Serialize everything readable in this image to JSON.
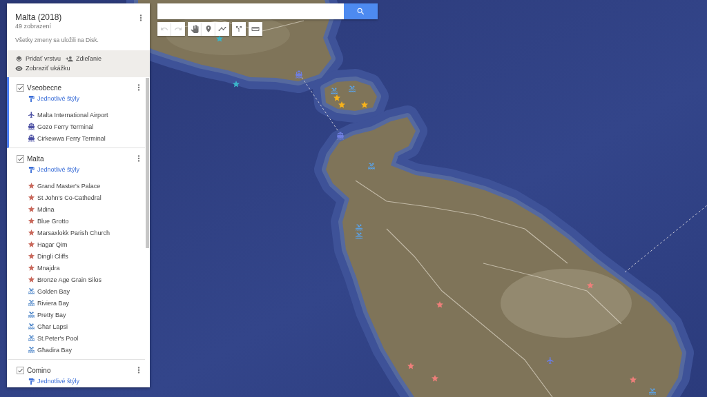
{
  "map": {
    "title": "Malta (2018)",
    "views": "49 zobrazení",
    "save_status": "Všetky zmeny sa uložili na Disk.",
    "actions": [
      {
        "kind": "add_layer",
        "label": "Pridať vrstvu"
      },
      {
        "kind": "share",
        "label": "Zdieľanie"
      },
      {
        "kind": "preview",
        "label": "Zobraziť ukážku"
      }
    ],
    "layers": [
      {
        "name": "Vseobecne",
        "checked": true,
        "selected": true,
        "style_link": "Jednotlivé štýly",
        "places": [
          {
            "name": "Malta International Airport",
            "kind": "airport"
          },
          {
            "name": "Gozo Ferry Terminal",
            "kind": "ferry"
          },
          {
            "name": "Cirkewwa Ferry Terminal",
            "kind": "ferry"
          }
        ]
      },
      {
        "name": "Malta",
        "checked": true,
        "selected": false,
        "style_link": "Jednotlivé štýly",
        "places": [
          {
            "name": "Grand Master's Palace",
            "kind": "star"
          },
          {
            "name": "St John's Co-Cathedral",
            "kind": "star"
          },
          {
            "name": "Mdina",
            "kind": "star"
          },
          {
            "name": "Blue Grotto",
            "kind": "star"
          },
          {
            "name": "Marsaxlokk Parish Church",
            "kind": "star"
          },
          {
            "name": "Hagar Qim",
            "kind": "star"
          },
          {
            "name": "Dingli Cliffs",
            "kind": "star"
          },
          {
            "name": "Mnajdra",
            "kind": "star"
          },
          {
            "name": "Bronze Age Grain Silos",
            "kind": "star"
          },
          {
            "name": "Golden Bay",
            "kind": "beach"
          },
          {
            "name": "Riviera Bay",
            "kind": "beach"
          },
          {
            "name": "Pretty Bay",
            "kind": "beach"
          },
          {
            "name": "Għar Lapsi",
            "kind": "beach"
          },
          {
            "name": "St.Peter's Pool",
            "kind": "beach"
          },
          {
            "name": "Għadira Bay",
            "kind": "beach"
          }
        ]
      },
      {
        "name": "Comino",
        "checked": true,
        "selected": false,
        "style_link": "Jednotlivé štýly"
      }
    ]
  },
  "toolbar": {
    "groups": [
      {
        "tools": [
          {
            "kind": "undo",
            "disabled": true
          },
          {
            "kind": "redo",
            "disabled": true
          }
        ]
      },
      {
        "tools": [
          {
            "kind": "hand",
            "disabled": false
          },
          {
            "kind": "marker",
            "disabled": false
          },
          {
            "kind": "line",
            "disabled": false
          }
        ]
      },
      {
        "tools": [
          {
            "kind": "route",
            "disabled": false
          }
        ]
      },
      {
        "tools": [
          {
            "kind": "ruler",
            "disabled": false
          }
        ]
      }
    ]
  }
}
